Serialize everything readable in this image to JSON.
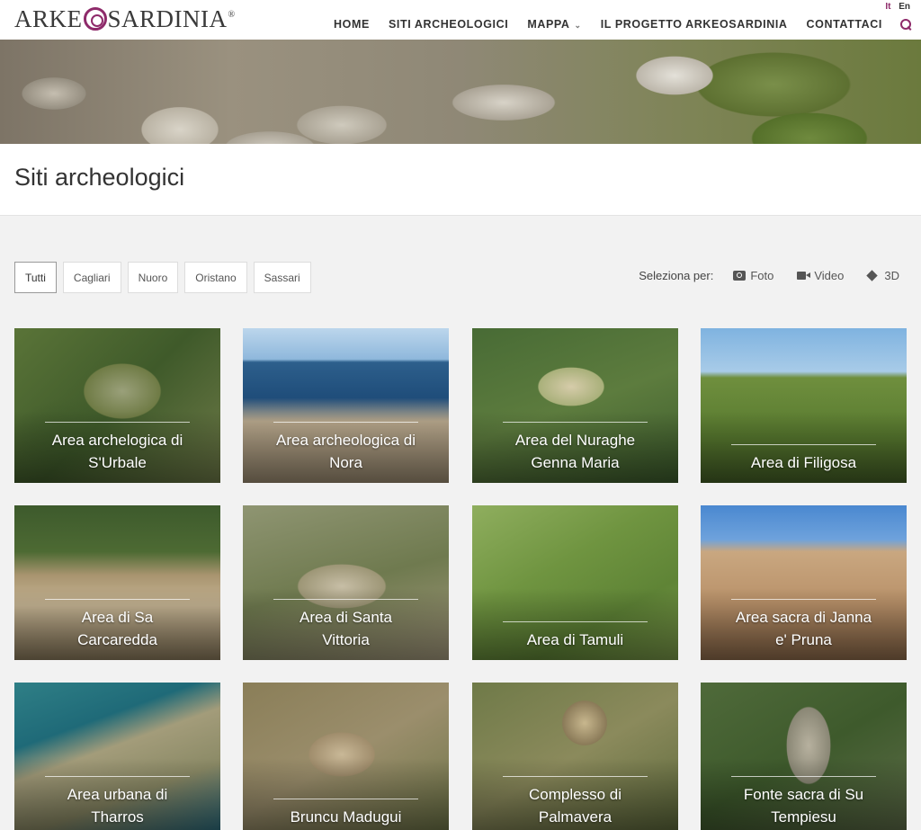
{
  "header": {
    "logo_left": "ARKE",
    "logo_right": "SARDINIA",
    "logo_reg": "®",
    "lang": [
      "It",
      "En"
    ],
    "nav": [
      {
        "label": "HOME"
      },
      {
        "label": "SITI ARCHEOLOGICI"
      },
      {
        "label": "MAPPA",
        "dropdown": true
      },
      {
        "label": "IL PROGETTO ARKEOSARDINIA"
      },
      {
        "label": "CONTATTACI"
      }
    ],
    "accent": "#8e2a6a"
  },
  "page": {
    "title": "Siti archeologici"
  },
  "filters": {
    "buttons": [
      "Tutti",
      "Cagliari",
      "Nuoro",
      "Oristano",
      "Sassari"
    ],
    "active": "Tutti",
    "select_label": "Seleziona per:",
    "media": [
      {
        "label": "Foto",
        "icon": "camera-icon"
      },
      {
        "label": "Video",
        "icon": "video-icon"
      },
      {
        "label": "3D",
        "icon": "cube-icon"
      }
    ]
  },
  "sites": [
    {
      "line1": "Area archelogica di",
      "line2": "S'Urbale"
    },
    {
      "line1": "Area archeologica di",
      "line2": "Nora"
    },
    {
      "line1": "Area del Nuraghe",
      "line2": "Genna Maria"
    },
    {
      "line1": "Area di Filigosa",
      "line2": ""
    },
    {
      "line1": "Area di Sa",
      "line2": "Carcaredda"
    },
    {
      "line1": "Area di Santa",
      "line2": "Vittoria"
    },
    {
      "line1": "Area di Tamuli",
      "line2": ""
    },
    {
      "line1": "Area sacra di Janna",
      "line2": "e' Pruna"
    },
    {
      "line1": "Area urbana di",
      "line2": "Tharros"
    },
    {
      "line1": "Bruncu Madugui",
      "line2": ""
    },
    {
      "line1": "Complesso di",
      "line2": "Palmavera"
    },
    {
      "line1": "Fonte sacra di Su",
      "line2": "Tempiesu"
    }
  ]
}
